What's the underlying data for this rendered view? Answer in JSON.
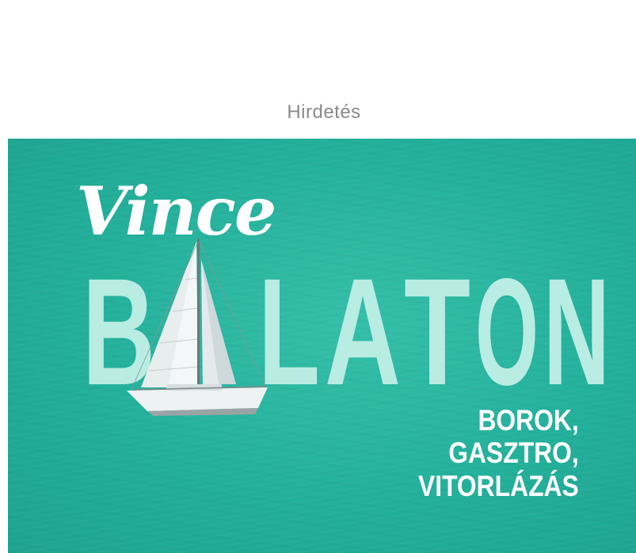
{
  "ad_label": "Hirdetés",
  "banner": {
    "brand": "Vince",
    "headline": "BALATON",
    "headline_letters": [
      "B",
      "A",
      "L",
      "A",
      "T",
      "O",
      "N"
    ],
    "tagline_lines": [
      "BOROK,",
      "GASZTRO,",
      "VITORLÁZÁS"
    ],
    "colors": {
      "background": "#23b09b",
      "headline": "#b9ece2",
      "text": "#ffffff"
    },
    "image": "sailboat-icon"
  }
}
